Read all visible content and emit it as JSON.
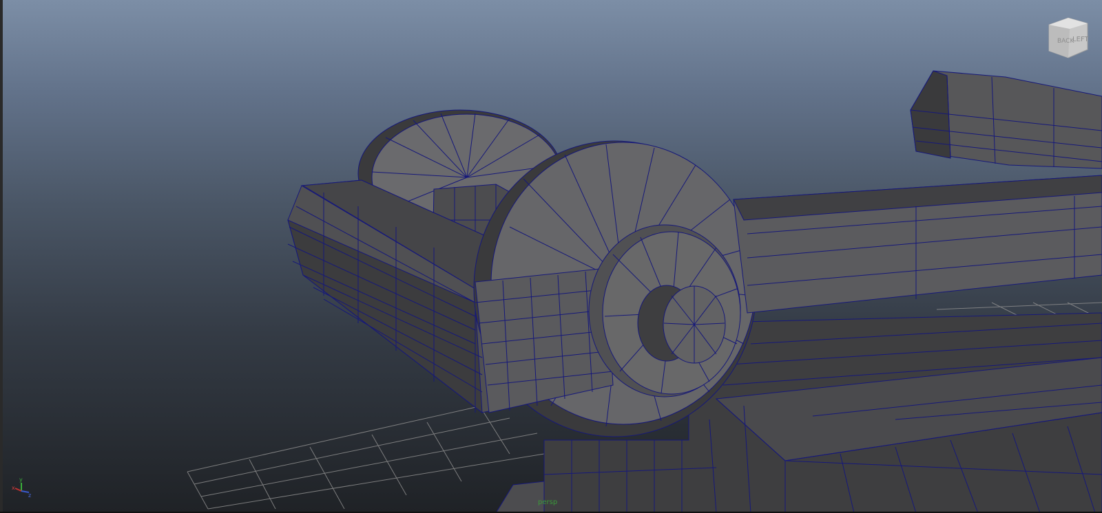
{
  "viewport": {
    "camera_name": "persp",
    "viewcube": {
      "faces": [
        "LEFT",
        "BACK"
      ]
    },
    "axis": {
      "x": "x",
      "y": "y",
      "z": "z"
    },
    "colors": {
      "wire": "#16187a",
      "grid": "#8d8d8d",
      "mesh_dark": "#3b3b3d",
      "mesh_mid": "#575759",
      "mesh_light": "#6a6a6d"
    }
  }
}
